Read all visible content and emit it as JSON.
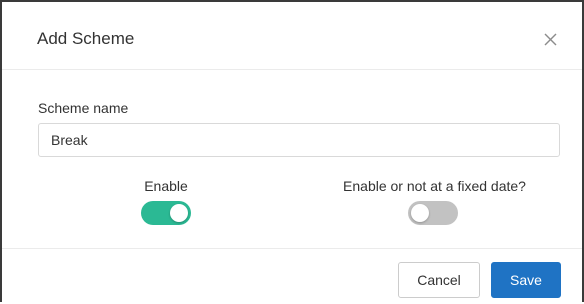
{
  "dialog": {
    "title": "Add Scheme",
    "close_icon": "close-icon"
  },
  "form": {
    "scheme_name": {
      "label": "Scheme name",
      "value": "Break"
    },
    "enable": {
      "label": "Enable",
      "state": "on"
    },
    "fixed_date": {
      "label": "Enable or not at a fixed date?",
      "state": "off"
    }
  },
  "footer": {
    "cancel_label": "Cancel",
    "save_label": "Save"
  },
  "colors": {
    "toggle_on": "#2bb994",
    "toggle_off": "#c2c2c2",
    "primary_button": "#1f73c4"
  }
}
